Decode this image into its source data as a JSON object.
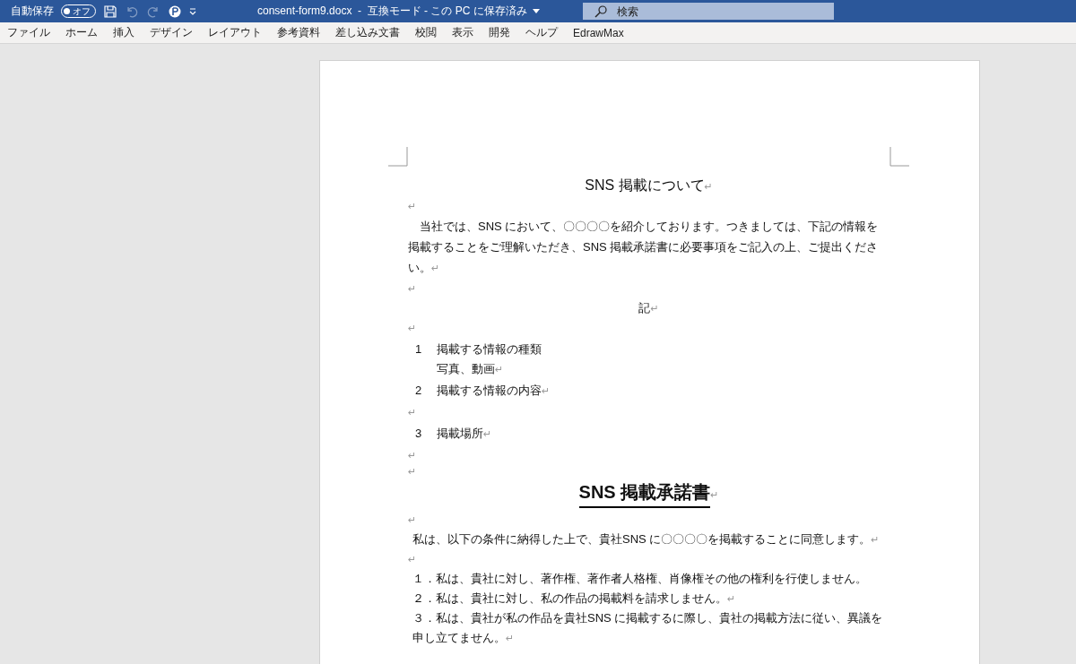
{
  "title_bar": {
    "autosave_label": "自動保存",
    "autosave_toggle": {
      "label": "オフ",
      "on": false
    },
    "undo_disabled": true,
    "document_title": "consent-form9.docx  -  互換モード - この PC に保存済み",
    "search": {
      "placeholder": "検索"
    }
  },
  "ribbon_tabs": [
    {
      "label": "ファイル",
      "selected": false
    },
    {
      "label": "ホーム",
      "selected": false
    },
    {
      "label": "挿入",
      "selected": false
    },
    {
      "label": "デザイン",
      "selected": false
    },
    {
      "label": "レイアウト",
      "selected": false
    },
    {
      "label": "参考資料",
      "selected": false
    },
    {
      "label": "差し込み文書",
      "selected": false
    },
    {
      "label": "校閲",
      "selected": false
    },
    {
      "label": "表示",
      "selected": false
    },
    {
      "label": "開発",
      "selected": false
    },
    {
      "label": "ヘルプ",
      "selected": false
    },
    {
      "label": "EdrawMax",
      "selected": false
    }
  ],
  "document": {
    "paragraphs": [
      {
        "kind": "title",
        "text": "SNS 掲載について",
        "mark": "↵"
      },
      {
        "kind": "empty",
        "mark": "↵"
      },
      {
        "kind": "body",
        "text": "当社では、SNS において、〇〇〇〇を紹介しております。つきましては、下記の情報を掲載することをご理解いただき、SNS 掲載承諾書に必要事項をご記入の上、ご提出ください。",
        "mark": "↵"
      },
      {
        "kind": "empty",
        "mark": "↵"
      },
      {
        "kind": "center",
        "text": "記",
        "mark": "↵"
      },
      {
        "kind": "empty",
        "mark": "↵"
      },
      {
        "kind": "item",
        "number": "1",
        "text": "掲載する情報の種類",
        "subtext": "写真、動画",
        "mark": "↵"
      },
      {
        "kind": "item",
        "number": "2",
        "text": "掲載する情報の内容",
        "mark": "↵"
      },
      {
        "kind": "empty",
        "mark": "↵"
      },
      {
        "kind": "item",
        "number": "3",
        "text": "掲載場所",
        "mark": "↵"
      },
      {
        "kind": "empty",
        "mark": "↵"
      },
      {
        "kind": "small_empty",
        "mark": "↵"
      },
      {
        "kind": "heading",
        "text": "SNS 掲載承諾書",
        "mark": "↵"
      },
      {
        "kind": "empty",
        "mark": "↵"
      },
      {
        "kind": "plain",
        "text": "私は、以下の条件に納得した上で、貴社SNS に〇〇〇〇を掲載することに同意します。",
        "mark": "↵"
      },
      {
        "kind": "empty",
        "mark": "↵"
      },
      {
        "kind": "plain",
        "text": "１．私は、貴社に対し、著作権、著作者人格権、肖像権その他の権利を行使しません。"
      },
      {
        "kind": "plain",
        "text": "２．私は、貴社に対し、私の作品の掲載料を請求しません。",
        "mark": "↵"
      },
      {
        "kind": "plain",
        "text": "３．私は、貴社が私の作品を貴社SNS に掲載するに際し、貴社の掲載方法に従い、異議を申し立てません。",
        "mark": "↵"
      }
    ]
  }
}
